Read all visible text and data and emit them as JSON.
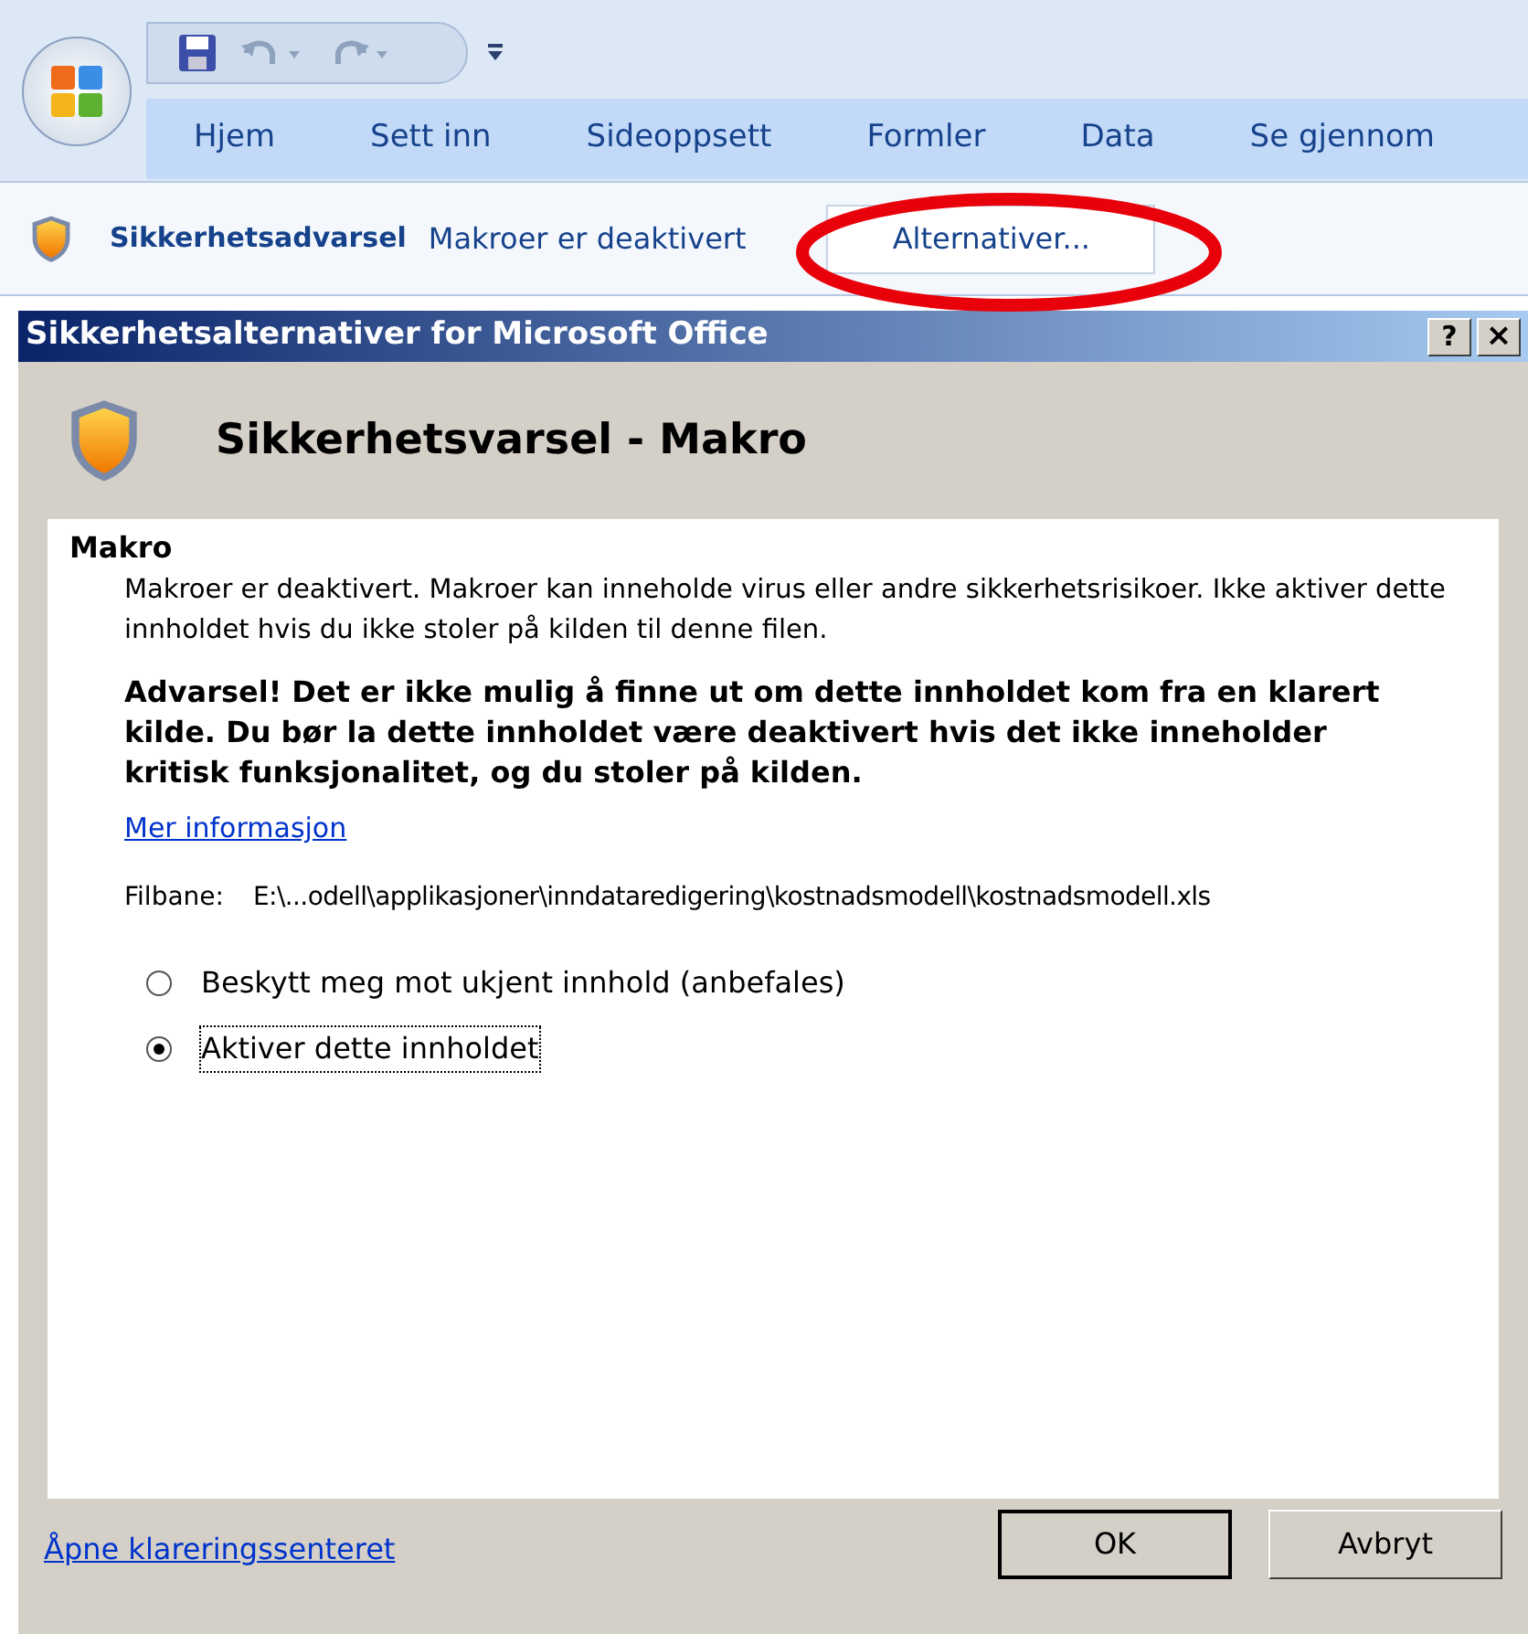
{
  "ribbon": {
    "tabs": [
      {
        "label": "Hjem"
      },
      {
        "label": "Sett inn"
      },
      {
        "label": "Sideoppsett"
      },
      {
        "label": "Formler"
      },
      {
        "label": "Data"
      },
      {
        "label": "Se gjennom"
      }
    ]
  },
  "message_bar": {
    "title": "Sikkerhetsadvarsel",
    "text": "Makroer er deaktivert",
    "button": "Alternativer...",
    "highlighted": true
  },
  "dialog": {
    "title": "Sikkerhetsalternativer for Microsoft Office",
    "help_button": "?",
    "close_button": "×",
    "heading": "Sikkerhetsvarsel - Makro",
    "section": "Makro",
    "description": "Makroer er deaktivert. Makroer kan inneholde virus eller andre sikkerhetsrisikoer. Ikke aktiver dette innholdet hvis du ikke stoler på kilden til denne filen.",
    "warning": "Advarsel!  Det er ikke mulig å finne ut om dette innholdet kom fra en klarert kilde. Du bør la dette innholdet være deaktivert hvis det ikke inneholder kritisk funksjonalitet, og du stoler på kilden.",
    "more_info_link": "Mer informasjon",
    "file_path_label": "Filbane:",
    "file_path": "E:\\...odell\\applikasjoner\\inndataredigering\\kostnadsmodell\\kostnadsmodell.xls",
    "options": [
      {
        "label": "Beskytt meg mot ukjent innhold (anbefales)",
        "selected": false
      },
      {
        "label": "Aktiver dette innholdet",
        "selected": true
      }
    ],
    "trust_center_link": "Åpne klareringssenteret",
    "ok_button": "OK",
    "cancel_button": "Avbryt"
  }
}
